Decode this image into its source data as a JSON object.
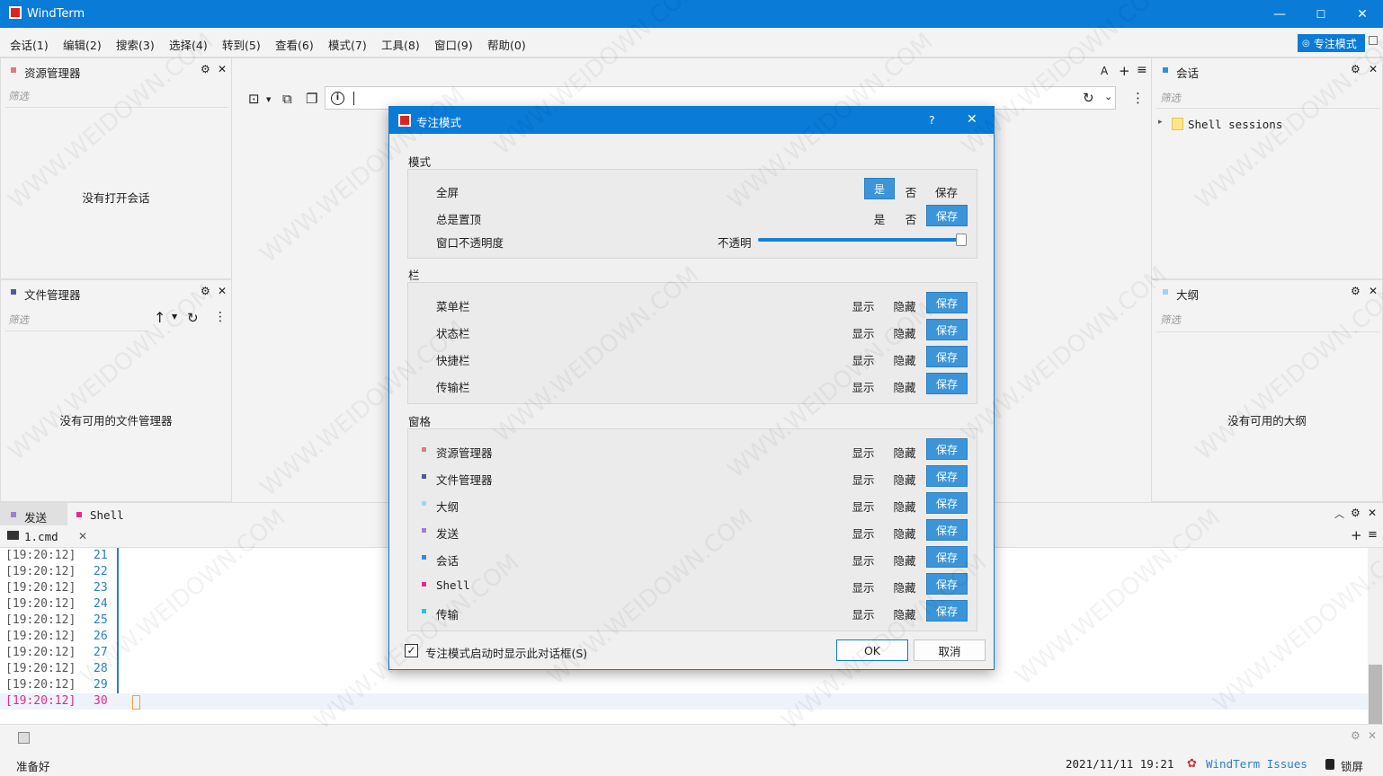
{
  "window": {
    "title": "WindTerm",
    "min": "—",
    "max": "☐",
    "close": "✕"
  },
  "menu": [
    "会话(1)",
    "编辑(2)",
    "搜索(3)",
    "选择(4)",
    "转到(5)",
    "查看(6)",
    "模式(7)",
    "工具(8)",
    "窗口(9)",
    "帮助(0)"
  ],
  "focus_mode_button": "专注模式",
  "explorer": {
    "title": "资源管理器",
    "filter": "筛选",
    "empty": "没有打开会话"
  },
  "filemanager": {
    "title": "文件管理器",
    "filter": "筛选",
    "empty": "没有可用的文件管理器"
  },
  "sessions": {
    "title": "会话",
    "filter": "筛选",
    "item": "Shell sessions"
  },
  "outline": {
    "title": "大纲",
    "filter": "筛选",
    "empty": "没有可用的大纲"
  },
  "toolbar": {
    "font_label": "A",
    "add": "+",
    "more": "≡"
  },
  "bottom_tabs": {
    "send": "发送",
    "shell": "Shell",
    "file_tab": "1.cmd"
  },
  "terminal": {
    "lines": [
      {
        "time": "[19:20:12]",
        "num": "21"
      },
      {
        "time": "[19:20:12]",
        "num": "22"
      },
      {
        "time": "[19:20:12]",
        "num": "23"
      },
      {
        "time": "[19:20:12]",
        "num": "24"
      },
      {
        "time": "[19:20:12]",
        "num": "25"
      },
      {
        "time": "[19:20:12]",
        "num": "26"
      },
      {
        "time": "[19:20:12]",
        "num": "27"
      },
      {
        "time": "[19:20:12]",
        "num": "28"
      },
      {
        "time": "[19:20:12]",
        "num": "29"
      },
      {
        "time": "[19:20:12]",
        "num": "30"
      }
    ]
  },
  "dialog": {
    "title": "专注模式",
    "help": "?",
    "close": "✕",
    "mode_section": "模式",
    "fullscreen": {
      "label": "全屏",
      "yes": "是",
      "no": "否",
      "save": "保存"
    },
    "always_top": {
      "label": "总是置顶",
      "yes": "是",
      "no": "否",
      "save": "保存"
    },
    "opacity": {
      "label": "窗口不透明度",
      "value_label": "不透明",
      "level": 1.0
    },
    "bar_section": "栏",
    "bars": [
      {
        "label": "菜单栏",
        "show": "显示",
        "hide": "隐藏",
        "save": "保存"
      },
      {
        "label": "状态栏",
        "show": "显示",
        "hide": "隐藏",
        "save": "保存"
      },
      {
        "label": "快捷栏",
        "show": "显示",
        "hide": "隐藏",
        "save": "保存"
      },
      {
        "label": "传输栏",
        "show": "显示",
        "hide": "隐藏",
        "save": "保存"
      }
    ],
    "pane_section": "窗格",
    "panes": [
      {
        "label": "资源管理器",
        "color": "#e8787a",
        "show": "显示",
        "hide": "隐藏",
        "save": "保存"
      },
      {
        "label": "文件管理器",
        "color": "#4a5aa8",
        "show": "显示",
        "hide": "隐藏",
        "save": "保存"
      },
      {
        "label": "大纲",
        "color": "#9fd6ef",
        "show": "显示",
        "hide": "隐藏",
        "save": "保存"
      },
      {
        "label": "发送",
        "color": "#9b7fd9",
        "show": "显示",
        "hide": "隐藏",
        "save": "保存"
      },
      {
        "label": "会话",
        "color": "#2a8ee8",
        "show": "显示",
        "hide": "隐藏",
        "save": "保存"
      },
      {
        "label": "Shell",
        "color": "#e8288c",
        "show": "显示",
        "hide": "隐藏",
        "save": "保存"
      },
      {
        "label": "传输",
        "color": "#22c6d6",
        "show": "显示",
        "hide": "隐藏",
        "save": "保存"
      }
    ],
    "checkbox_label": "专注模式启动时显示此对话框(S)",
    "checkbox_checked": true,
    "ok": "OK",
    "cancel": "取消"
  },
  "status": {
    "ready": "准备好",
    "datetime": "2021/11/11 19:21",
    "issues": "WindTerm Issues",
    "lock": "锁屏"
  },
  "watermark": "WWW.WEIDOWN.COM",
  "colors": {
    "accent": "#0a7bd7",
    "save_btn": "#3b95d8",
    "explorer_dot": "#e8787a",
    "filemgr_dot": "#4a5aa8",
    "session_dot": "#2a8ee8",
    "outline_dot": "#9fd6ef",
    "send_dot": "#9b7fd9",
    "shell_dot": "#e8288c"
  }
}
